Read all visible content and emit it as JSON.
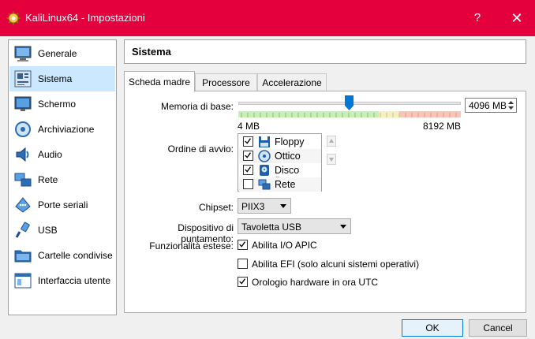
{
  "window": {
    "title": "KaliLinux64 - Impostazioni",
    "help_glyph": "?",
    "close_glyph": "✕",
    "accent": "#e3003d"
  },
  "sidebar": {
    "items": [
      {
        "label": "Generale",
        "icon": "monitor-icon"
      },
      {
        "label": "Sistema",
        "icon": "motherboard-icon",
        "selected": true
      },
      {
        "label": "Schermo",
        "icon": "display-icon"
      },
      {
        "label": "Archiviazione",
        "icon": "disk-icon"
      },
      {
        "label": "Audio",
        "icon": "speaker-icon"
      },
      {
        "label": "Rete",
        "icon": "network-icon"
      },
      {
        "label": "Porte seriali",
        "icon": "serial-port-icon"
      },
      {
        "label": "USB",
        "icon": "usb-icon"
      },
      {
        "label": "Cartelle condivise",
        "icon": "folder-icon"
      },
      {
        "label": "Interfaccia utente",
        "icon": "window-icon"
      }
    ]
  },
  "header": {
    "title": "Sistema"
  },
  "tabs": [
    {
      "label": "Scheda madre",
      "active": true
    },
    {
      "label": "Processore"
    },
    {
      "label": "Accelerazione"
    }
  ],
  "memory": {
    "label": "Memoria di base:",
    "value": "4096 MB",
    "value_mb": 4096,
    "min_label": "4 MB",
    "max_label": "8192 MB",
    "min_mb": 4,
    "max_mb": 8192
  },
  "boot": {
    "label": "Ordine di avvio:",
    "items": [
      {
        "label": "Floppy",
        "checked": true,
        "icon": "floppy-icon"
      },
      {
        "label": "Ottico",
        "checked": true,
        "icon": "optical-disc-icon"
      },
      {
        "label": "Disco fisso",
        "checked": true,
        "icon": "hard-disk-icon"
      },
      {
        "label": "Rete",
        "checked": false,
        "icon": "network-icon"
      }
    ]
  },
  "chipset": {
    "label": "Chipset:",
    "value": "PIIX3"
  },
  "pointing": {
    "label": "Dispositivo di puntamento:",
    "value": "Tavoletta USB"
  },
  "features": {
    "label": "Funzionalità estese:",
    "options": [
      {
        "label": "Abilita I/O APIC",
        "checked": true
      },
      {
        "label": "Abilita EFI (solo alcuni sistemi operativi)",
        "checked": false
      },
      {
        "label": "Orologio hardware in ora UTC",
        "checked": true
      }
    ]
  },
  "buttons": {
    "ok": "OK",
    "cancel": "Cancel"
  }
}
